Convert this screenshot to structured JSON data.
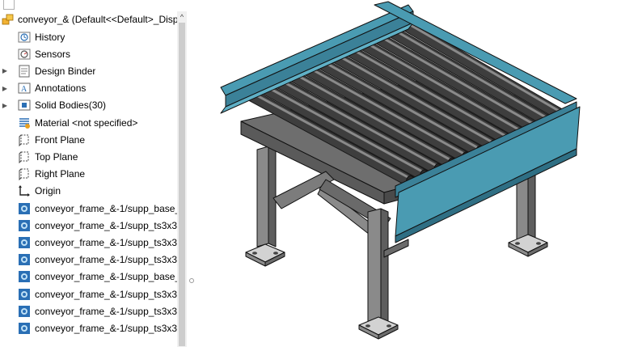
{
  "feature_tree": {
    "root": {
      "label": "conveyor_&  (Default<<Default>_Disp",
      "icon": "assembly-icon"
    },
    "items": [
      {
        "label": "History",
        "icon": "history-folder-icon",
        "expandable": false
      },
      {
        "label": "Sensors",
        "icon": "sensors-folder-icon",
        "expandable": false
      },
      {
        "label": "Design Binder",
        "icon": "design-binder-icon",
        "expandable": true
      },
      {
        "label": "Annotations",
        "icon": "annotations-icon",
        "expandable": true
      },
      {
        "label": "Solid Bodies(30)",
        "icon": "solid-bodies-icon",
        "expandable": true
      },
      {
        "label": "Material <not specified>",
        "icon": "material-icon",
        "expandable": false
      },
      {
        "label": "Front Plane",
        "icon": "plane-icon",
        "expandable": false
      },
      {
        "label": "Top Plane",
        "icon": "plane-icon",
        "expandable": false
      },
      {
        "label": "Right Plane",
        "icon": "plane-icon",
        "expandable": false
      },
      {
        "label": "Origin",
        "icon": "origin-icon",
        "expandable": false
      },
      {
        "label": "conveyor_frame_&-1/supp_base_",
        "icon": "body-part-icon",
        "expandable": false
      },
      {
        "label": "conveyor_frame_&-1/supp_ts3x3_",
        "icon": "body-part-icon",
        "expandable": false
      },
      {
        "label": "conveyor_frame_&-1/supp_ts3x3_",
        "icon": "body-part-icon",
        "expandable": false
      },
      {
        "label": "conveyor_frame_&-1/supp_ts3x3_",
        "icon": "body-part-icon",
        "expandable": false
      },
      {
        "label": "conveyor_frame_&-1/supp_base_",
        "icon": "body-part-icon",
        "expandable": false
      },
      {
        "label": "conveyor_frame_&-1/supp_ts3x3_",
        "icon": "body-part-icon",
        "expandable": false
      },
      {
        "label": "conveyor_frame_&-1/supp_ts3x3_",
        "icon": "body-part-icon",
        "expandable": false
      },
      {
        "label": "conveyor_frame_&-1/supp_ts3x3",
        "icon": "body-part-icon",
        "expandable": false
      }
    ]
  },
  "colors": {
    "channel_blue": "#4a9bb2",
    "steel_grey": "#7a7a7a",
    "roller_dark": "#3e3e3e",
    "body_icon_blue": "#2a6fb5"
  },
  "viewport": {
    "model_icon": "conveyor-assembly-model"
  }
}
